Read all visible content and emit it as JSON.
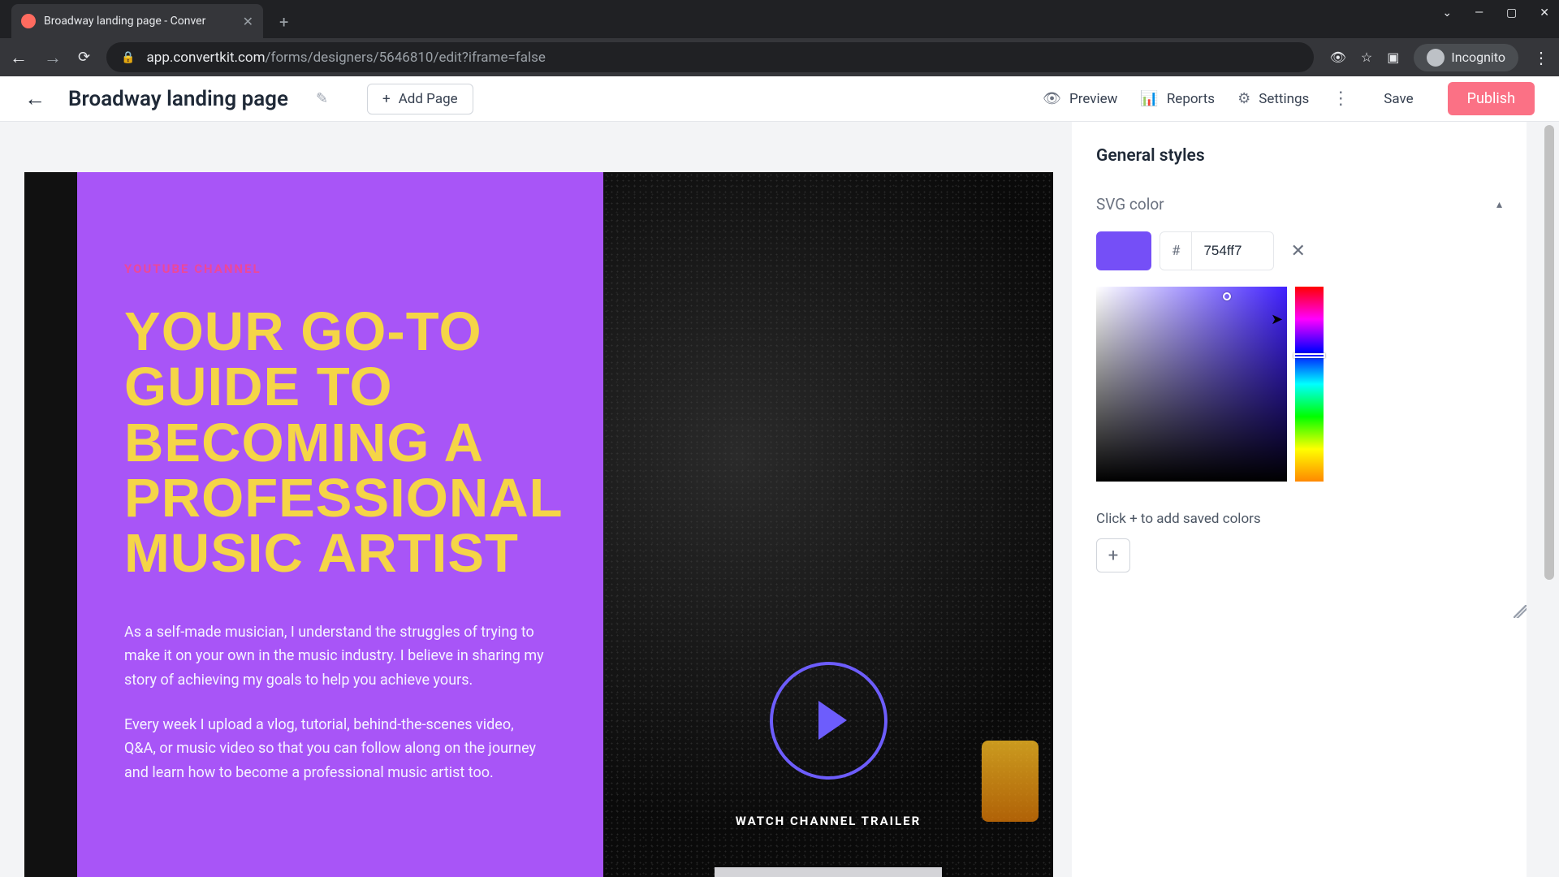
{
  "browser": {
    "tab_title": "Broadway landing page - Conver",
    "url_host": "app.convertkit.com",
    "url_path": "/forms/designers/5646810/edit?iframe=false",
    "incognito_label": "Incognito"
  },
  "toolbar": {
    "page_name": "Broadway landing page",
    "add_page": "Add Page",
    "preview": "Preview",
    "reports": "Reports",
    "settings": "Settings",
    "save": "Save",
    "publish": "Publish"
  },
  "canvas": {
    "eyebrow": "YOUTUBE CHANNEL",
    "headline": "YOUR GO-TO GUIDE TO BECOMING A PROFESSIONAL MUSIC ARTIST",
    "para1": "As a self-made musician, I understand the struggles of trying to make it on your own in the music industry. I believe in sharing my story of achieving my goals to help you achieve yours.",
    "para2": "Every week I upload a vlog, tutorial, behind-the-scenes video, Q&A, or music video so that you can follow along on the journey and learn how to become a professional music artist too.",
    "trailer": "WATCH CHANNEL TRAILER"
  },
  "panel": {
    "heading": "General styles",
    "section": "SVG color",
    "hex": "754ff7",
    "hash": "#",
    "saved_hint": "Click + to add saved colors"
  }
}
